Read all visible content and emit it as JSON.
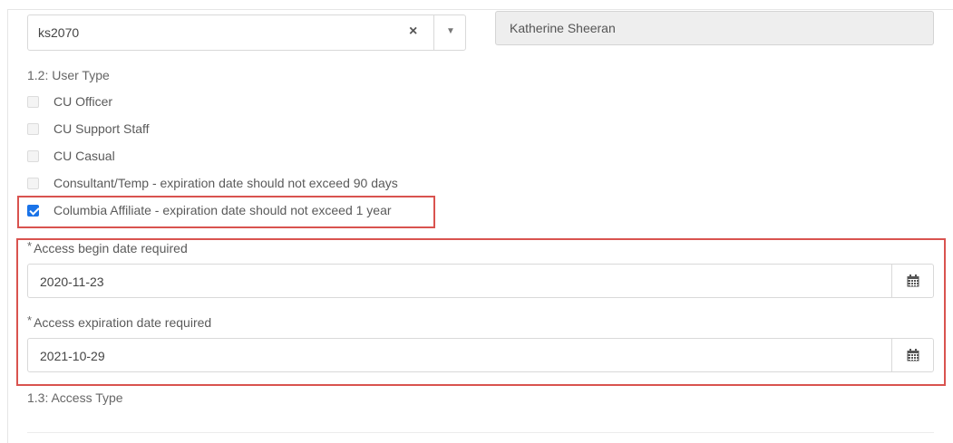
{
  "user_select": {
    "value": "ks2070",
    "clear_symbol": "×",
    "arrow_symbol": "▼"
  },
  "user_name": "Katherine Sheeran",
  "user_type": {
    "heading": "1.2: User Type",
    "options": [
      {
        "label": "CU Officer",
        "checked": false
      },
      {
        "label": "CU Support Staff",
        "checked": false
      },
      {
        "label": "CU Casual",
        "checked": false
      },
      {
        "label": "Consultant/Temp - expiration date should not exceed 90 days",
        "checked": false
      },
      {
        "label": "Columbia Affiliate - expiration date should not exceed 1 year",
        "checked": true
      }
    ]
  },
  "access_begin": {
    "star": "*",
    "label": "Access begin date required",
    "value": "2020-11-23",
    "icon": "calendar-icon"
  },
  "access_expiration": {
    "star": "*",
    "label": "Access expiration date required",
    "value": "2021-10-29",
    "icon": "calendar-icon"
  },
  "access_type": {
    "heading": "1.3: Access Type"
  },
  "colors": {
    "highlight": "#d9534f",
    "checkbox_checked": "#1a73e8"
  }
}
